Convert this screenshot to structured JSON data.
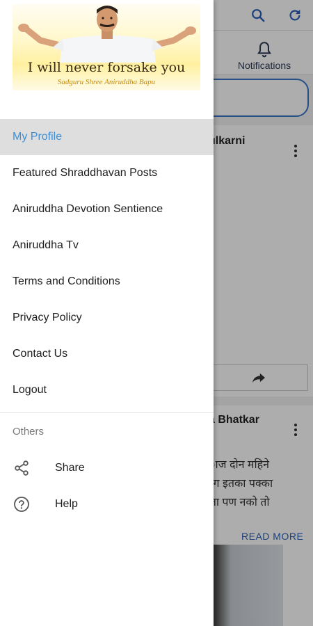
{
  "colors": {
    "accent": "#3d8fd6",
    "active_bg": "#dedede",
    "link_blue": "#2a5fb5",
    "scrim": "rgba(0,0,0,0.32)"
  },
  "background": {
    "notifications_label": "Notifications",
    "card1": {
      "name": "ulkarni"
    },
    "card2": {
      "name": "a Bhatkar",
      "text_lines": [
        "ाज दोन महिने",
        "रंग इतका पक्का",
        "ला  पण नको तो"
      ],
      "read_more": "READ MORE"
    }
  },
  "drawer": {
    "banner": {
      "title": "I will never forsake you",
      "subtitle": "Sadguru Shree Aniruddha Bapu"
    },
    "menu": [
      {
        "label": "My Profile",
        "active": true
      },
      {
        "label": "Featured Shraddhavan Posts",
        "active": false
      },
      {
        "label": "Aniruddha Devotion Sentience",
        "active": false
      },
      {
        "label": "Aniruddha Tv",
        "active": false
      },
      {
        "label": "Terms and Conditions",
        "active": false
      },
      {
        "label": "Privacy Policy",
        "active": false
      },
      {
        "label": "Contact Us",
        "active": false
      },
      {
        "label": "Logout",
        "active": false
      }
    ],
    "others": {
      "title": "Others",
      "items": [
        {
          "label": "Share",
          "icon": "share-icon"
        },
        {
          "label": "Help",
          "icon": "help-icon"
        }
      ]
    }
  }
}
